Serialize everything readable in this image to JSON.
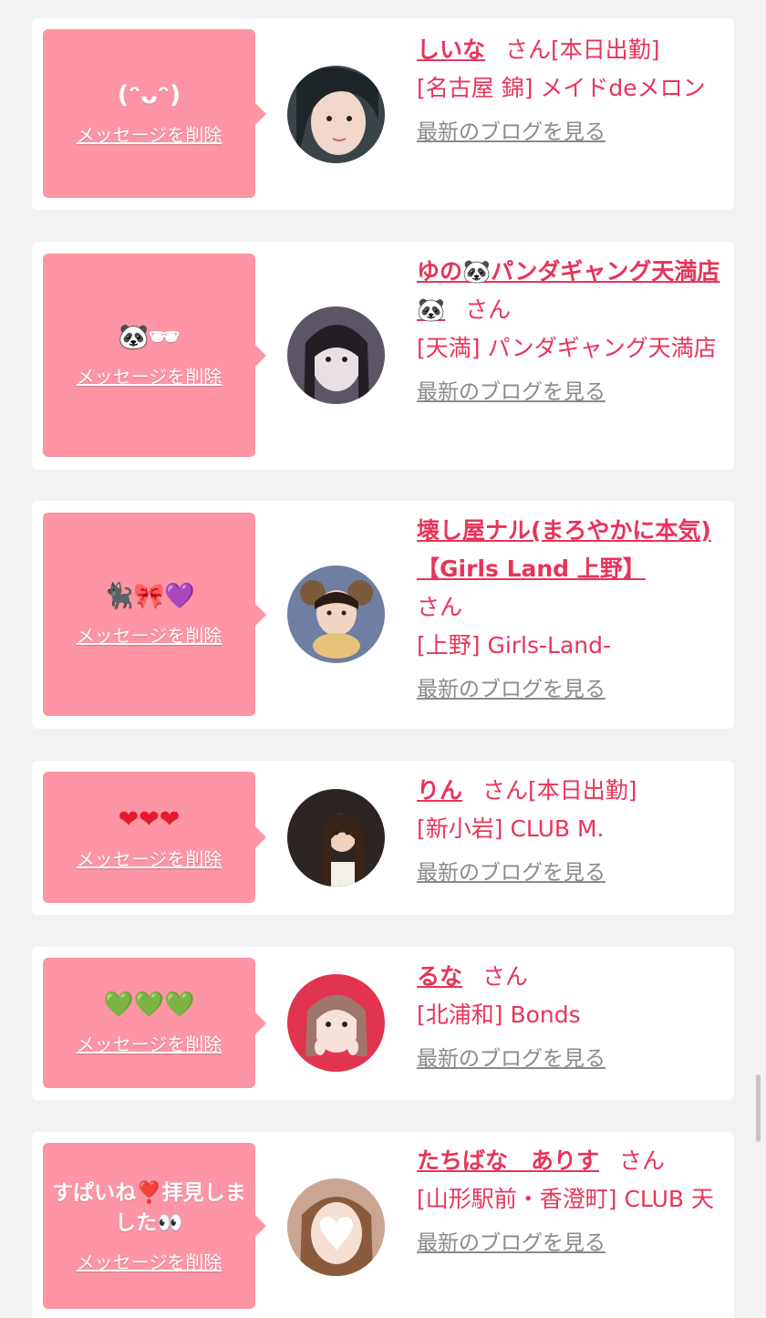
{
  "delete_label": "メッセージを削除",
  "san_label": "さん",
  "blog_label": "最新のブログを見る",
  "colors": {
    "bubble": "#fd95a4",
    "accent": "#e8345a",
    "muted": "#8a8a8a",
    "background": "#f2f2f2"
  },
  "cards": [
    {
      "message": "(ᵔᴗᵔ)",
      "name": "しいな",
      "status": "[本日出勤]",
      "shop": "[名古屋 錦] メイドdeメロン"
    },
    {
      "message": "🐼🕶",
      "name": "ゆの🐼パンダギャング天満店🐼",
      "status": "",
      "shop": "[天満] パンダギャング天満店"
    },
    {
      "message": "🐈‍⬛🎀💜",
      "name": "壊し屋ナル(まろやかに本気)【Girls Land 上野】",
      "status": "",
      "shop": "[上野] Girls-Land-"
    },
    {
      "message": "❤❤❤",
      "name": "りん",
      "status": "[本日出勤]",
      "shop": "[新小岩] CLUB M."
    },
    {
      "message": "💚💚💚",
      "name": "るな",
      "status": "",
      "shop": "[北浦和] Bonds"
    },
    {
      "message": "すぱいね❣️拝見しました👀",
      "name": "たちばな　ありす",
      "status": "",
      "shop": "[山形駅前・香澄町] CLUB 天"
    }
  ]
}
